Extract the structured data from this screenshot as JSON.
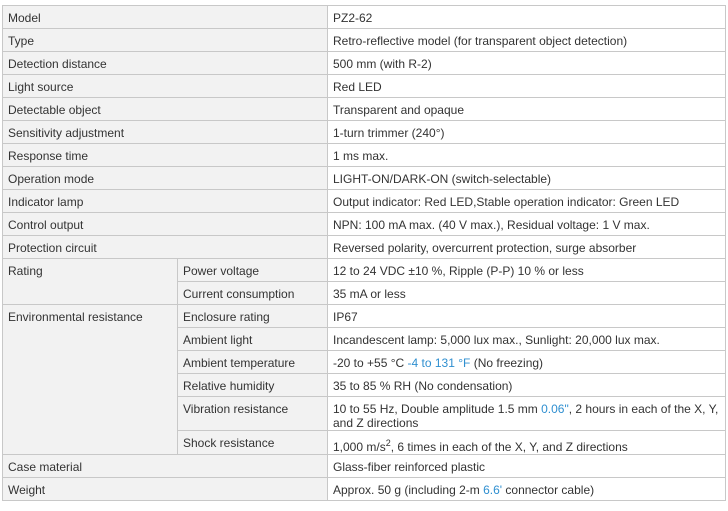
{
  "rows": {
    "model": {
      "label": "Model",
      "value": "PZ2-62"
    },
    "type": {
      "label": "Type",
      "value": "Retro-reflective model (for transparent object detection)"
    },
    "detection_distance": {
      "label": "Detection distance",
      "value": "500 mm (with R-2)"
    },
    "light_source": {
      "label": "Light source",
      "value": "Red LED"
    },
    "detectable_object": {
      "label": "Detectable object",
      "value": "Transparent and opaque"
    },
    "sensitivity_adjustment": {
      "label": "Sensitivity adjustment",
      "value": "1-turn trimmer (240°)"
    },
    "response_time": {
      "label": "Response time",
      "value": "1 ms max."
    },
    "operation_mode": {
      "label": "Operation mode",
      "value": "LIGHT-ON/DARK-ON (switch-selectable)"
    },
    "indicator_lamp": {
      "label": "Indicator lamp",
      "value": "Output indicator: Red LED,Stable operation indicator: Green LED"
    },
    "control_output": {
      "label": "Control output",
      "value": "NPN: 100 mA max. (40 V max.), Residual voltage: 1 V max."
    },
    "protection_circuit": {
      "label": "Protection circuit",
      "value": "Reversed polarity, overcurrent protection, surge absorber"
    },
    "case_material": {
      "label": "Case material",
      "value": "Glass-fiber reinforced plastic"
    },
    "weight": {
      "label": "Weight",
      "value_a": "Approx. 50 g (including 2-m ",
      "value_conv": "6.6'",
      "value_b": " connector cable)"
    }
  },
  "rating": {
    "label": "Rating",
    "power_voltage": {
      "label": "Power voltage",
      "value": "12 to 24 VDC ±10 %, Ripple (P-P) 10 % or less"
    },
    "current_consumption": {
      "label": "Current consumption",
      "value": "35 mA or less"
    }
  },
  "environmental": {
    "label": "Environmental resistance",
    "enclosure_rating": {
      "label": "Enclosure rating",
      "value": "IP67"
    },
    "ambient_light": {
      "label": "Ambient light",
      "value": "Incandescent lamp: 5,000 lux max., Sunlight: 20,000 lux max."
    },
    "ambient_temperature": {
      "label": "Ambient temperature",
      "value_a": "-20 to +55 °C ",
      "value_conv": "-4 to 131 °F",
      "value_b": " (No freezing)"
    },
    "relative_humidity": {
      "label": "Relative humidity",
      "value": "35 to 85 % RH (No condensation)"
    },
    "vibration_resistance": {
      "label": "Vibration resistance",
      "value_a": "10 to 55 Hz, Double amplitude 1.5 mm ",
      "value_conv": "0.06\"",
      "value_b": ", 2 hours in each of the X, Y, and Z directions"
    },
    "shock_resistance": {
      "label": "Shock resistance",
      "value_a": "1,000 m/s",
      "value_sup": "2",
      "value_b": ", 6 times in each of the X, Y, and Z directions"
    }
  }
}
